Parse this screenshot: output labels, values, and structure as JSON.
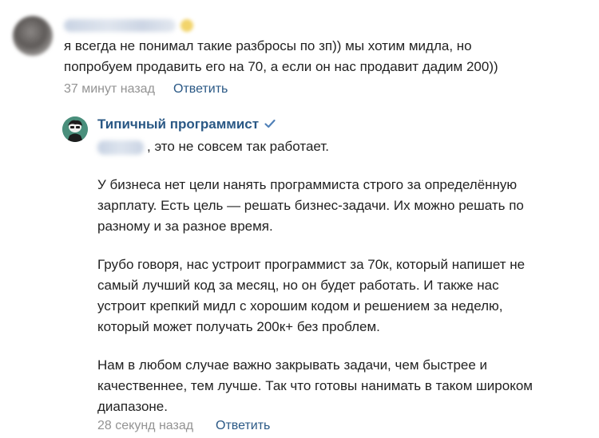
{
  "comment": {
    "lines": [
      "я всегда не понимал такие разбросы по зп)) мы хотим мидла, но",
      "попробуем продавить его на 70, а если он нас продавит дадим 200))"
    ],
    "time": "37 минут назад",
    "reply_label": "Ответить"
  },
  "reply": {
    "author": "Типичный программист",
    "verified_icon": "checkmark-icon",
    "first_line": ", это не совсем так работает.",
    "paragraph1": [
      "У бизнеса нет цели нанять программиста строго за определённую",
      "зарплату. Есть цель — решать бизнес-задачи. Их можно решать по",
      "разному и за разное время."
    ],
    "paragraph2": [
      "Грубо говоря, нас устроит программист за 70к, который напишет не",
      "самый лучший код за месяц, но он будет работать. И также нас",
      "устроит крепкий мидл с хорошим кодом и решением за неделю,",
      "который может получать 200к+ без проблем."
    ],
    "paragraph3": [
      "Нам в любом случае важно закрывать задачи, чем быстрее и",
      "качественнее, тем лучше. Так что готовы нанимать в таком широком",
      "диапазоне."
    ],
    "time": "28 секунд назад",
    "reply_label": "Ответить"
  },
  "colors": {
    "link": "#2a5885",
    "text": "#222222",
    "muted": "#939393",
    "verified": "#5181b8"
  }
}
